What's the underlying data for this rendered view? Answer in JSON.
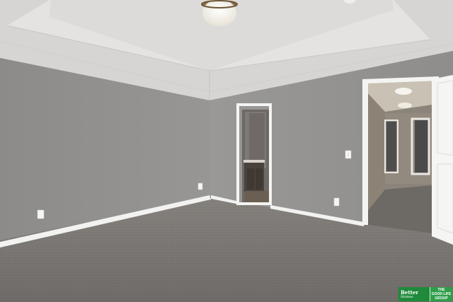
{
  "scene": {
    "type": "empty bedroom interior",
    "colors": {
      "ceiling": "#dddcdc",
      "tray_ceiling": "#e3e2e1",
      "left_wall": "#8f8e8d",
      "right_wall": "#959493",
      "baseboard": "#f2f2f0",
      "carpet": "#7a7673",
      "door_frame": "#f4f4f2",
      "hallway_wall": "#8a847a",
      "vanity": "#4a433d"
    },
    "icons": [
      "ceiling-light-icon",
      "smoke-detector-icon",
      "light-switch-icon",
      "outlet-icon"
    ]
  },
  "watermark": {
    "brand_line1": "Better",
    "brand_line2": "Homes",
    "group_line1": "THE",
    "group_line2": "GOOD LIFE",
    "group_line3": "GROUP"
  }
}
